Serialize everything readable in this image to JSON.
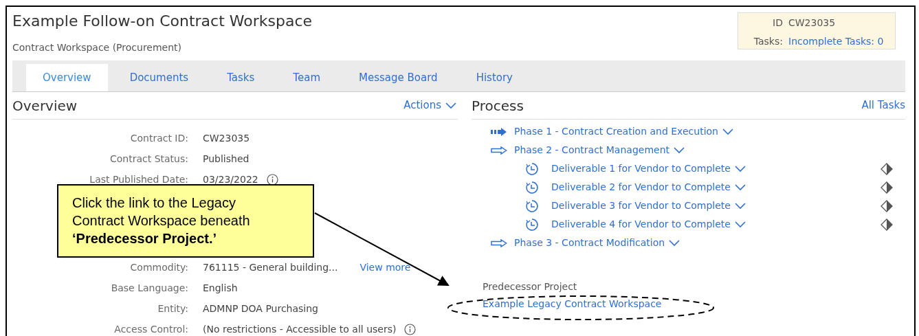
{
  "header": {
    "title": "Example Follow-on Contract Workspace",
    "subtitle": "Contract Workspace (Procurement)"
  },
  "info_box": {
    "id_label": "ID",
    "id_value": "CW23035",
    "tasks_label": "Tasks:",
    "tasks_link": "Incomplete Tasks: 0"
  },
  "tabs": [
    {
      "label": "Overview",
      "selected": true
    },
    {
      "label": "Documents",
      "selected": false
    },
    {
      "label": "Tasks",
      "selected": false
    },
    {
      "label": "Team",
      "selected": false
    },
    {
      "label": "Message Board",
      "selected": false
    },
    {
      "label": "History",
      "selected": false
    }
  ],
  "overview": {
    "heading": "Overview",
    "actions": "Actions",
    "fields_top": [
      {
        "label": "Contract ID:",
        "value": "CW23035",
        "info": false
      },
      {
        "label": "Contract Status:",
        "value": "Published",
        "info": false
      },
      {
        "label": "Last Published Date:",
        "value": "03/23/2022",
        "info": true
      }
    ],
    "fields_bottom": [
      {
        "label": "Commodity:",
        "value": "761115 - General building...",
        "link": "View more",
        "info": false
      },
      {
        "label": "Base Language:",
        "value": "English",
        "info": false
      },
      {
        "label": "Entity:",
        "value": "ADMNP DOA Purchasing",
        "info": false
      },
      {
        "label": "Access Control:",
        "value": "(No restrictions - Accessible to all users)",
        "info": true
      }
    ]
  },
  "process": {
    "heading": "Process",
    "all_tasks": "All Tasks",
    "items": [
      {
        "kind": "current-phase",
        "label": "Phase 1 - Contract Creation and Execution"
      },
      {
        "kind": "phase",
        "label": "Phase 2 - Contract Management",
        "children": [
          {
            "kind": "deliverable",
            "label": "Deliverable 1 for Vendor to Complete"
          },
          {
            "kind": "deliverable",
            "label": "Deliverable 2 for Vendor to Complete"
          },
          {
            "kind": "deliverable",
            "label": "Deliverable 3 for Vendor to Complete"
          },
          {
            "kind": "deliverable",
            "label": "Deliverable 4 for Vendor to Complete"
          }
        ]
      },
      {
        "kind": "phase",
        "label": "Phase 3 - Contract Modification"
      }
    ],
    "predecessor_label": "Predecessor Project",
    "predecessor_link": "Example Legacy Contract Workspace"
  },
  "callout": {
    "text": "Click the link to the Legacy Contract Workspace beneath **‘Predecessor Project.’**"
  }
}
